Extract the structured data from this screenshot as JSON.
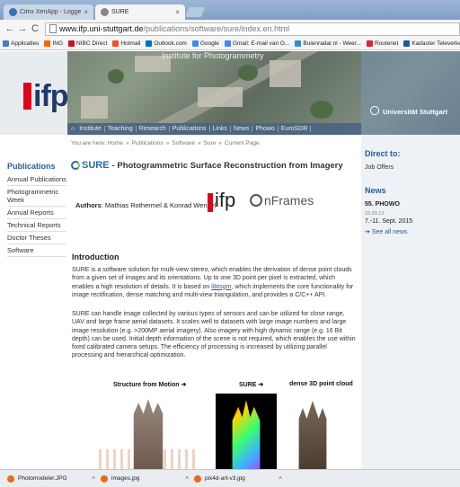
{
  "browser": {
    "tabs": [
      {
        "label": "Citrix XenApp - Logged O",
        "active": false
      },
      {
        "label": "SURE",
        "active": true
      }
    ],
    "tab_close": "×",
    "url_host": "www.ifp.uni-stuttgart.de",
    "url_path": "/publications/software/sure/index.en.html",
    "nav": {
      "back": "←",
      "forward": "→",
      "reload": "C"
    },
    "bookmarks": [
      {
        "label": "Applicaties",
        "color": "#4a7ac8"
      },
      {
        "label": "ING",
        "color": "#ff6200"
      },
      {
        "label": "NIBC Direct",
        "color": "#c8102e"
      },
      {
        "label": "Hotmail",
        "color": "#f25022"
      },
      {
        "label": "Outlook.com",
        "color": "#0072c6"
      },
      {
        "label": "Google",
        "color": "#4285f4"
      },
      {
        "label": "Gmail: E-mail van G...",
        "color": "#4285f4"
      },
      {
        "label": "Buienradar.nl - Weer...",
        "color": "#2a8fd8"
      },
      {
        "label": "Routenet",
        "color": "#d23"
      },
      {
        "label": "Kadaster Televerken...",
        "color": "#1a5aa0"
      }
    ]
  },
  "header": {
    "logo_text": "ifp",
    "title_fragment": "Institute for Photogrammetry",
    "university": "Universität Stuttgart"
  },
  "topnav": {
    "home_icon": "⌂",
    "items": [
      "Institute",
      "Teaching",
      "Research",
      "Publications",
      "Links",
      "News",
      "Phowo",
      "EuroSDR"
    ]
  },
  "breadcrumb": {
    "prefix": "You are here:",
    "items": [
      "Home",
      "Publications",
      "Software",
      "Sure",
      "Current Page"
    ],
    "separator": "»"
  },
  "sidebar_left": {
    "heading": "Publications",
    "items": [
      "Annual Publications",
      "Photogrammetric Week",
      "Annual Reports",
      "Technical Reports",
      "Doctor Theses",
      "Software"
    ]
  },
  "main": {
    "sure_logo": "SURE",
    "title": "- Photogrammetric Surface Reconstruction from Imagery",
    "authors_label": "Authors",
    "authors": ": Mathias Rothermel & Konrad Wenzel",
    "ifp_logo": "ifp",
    "nframes_logo": "nFrames",
    "intro_heading": "Introduction",
    "para1_a": "SURE is a software solution for multi-view stereo, which enables the derivation of dense point clouds from a given set of images and its orientations. Up to one 3D point per pixel is extracted, which enables a high resolution of details. It is based on ",
    "para1_link": "libtsgm",
    "para1_b": ", which implements the core functionality for image rectification, dense matching and multi-view triangulation, and provides a C/C++ API.",
    "para2": "SURE can handle image collected by various types of sensors and can be utilized for close range, UAV and large frame aerial datasets. It scales well to datasets with large image numbers and large image resolution (e.g. >200MP aerial imagery). Also imagery with high dynamic range (e.g. 16 Bit depth) can be used. Initial depth information of the scene is not required, which enables the use within fixed calibrated camera setups. The efficiency of processing is increased by utilizing parallel processing and hierarchical optimization.",
    "figures": [
      "Structure from Motion ➔",
      "SURE ➔",
      "dense 3D point cloud"
    ]
  },
  "sidebar_right": {
    "direct_heading": "Direct to:",
    "job_offers": "Job Offers",
    "news_heading": "News",
    "news_title": "55. PHOWO",
    "news_date": "15.09.13",
    "news_text": "7.-11. Sept. 2015",
    "see_all": "See all news"
  },
  "downloads": [
    {
      "label": "Photomodeler.JPG"
    },
    {
      "label": "images.jpg"
    },
    {
      "label": "pix4d-art-v3.jpg"
    }
  ],
  "download_chevron": "˄"
}
